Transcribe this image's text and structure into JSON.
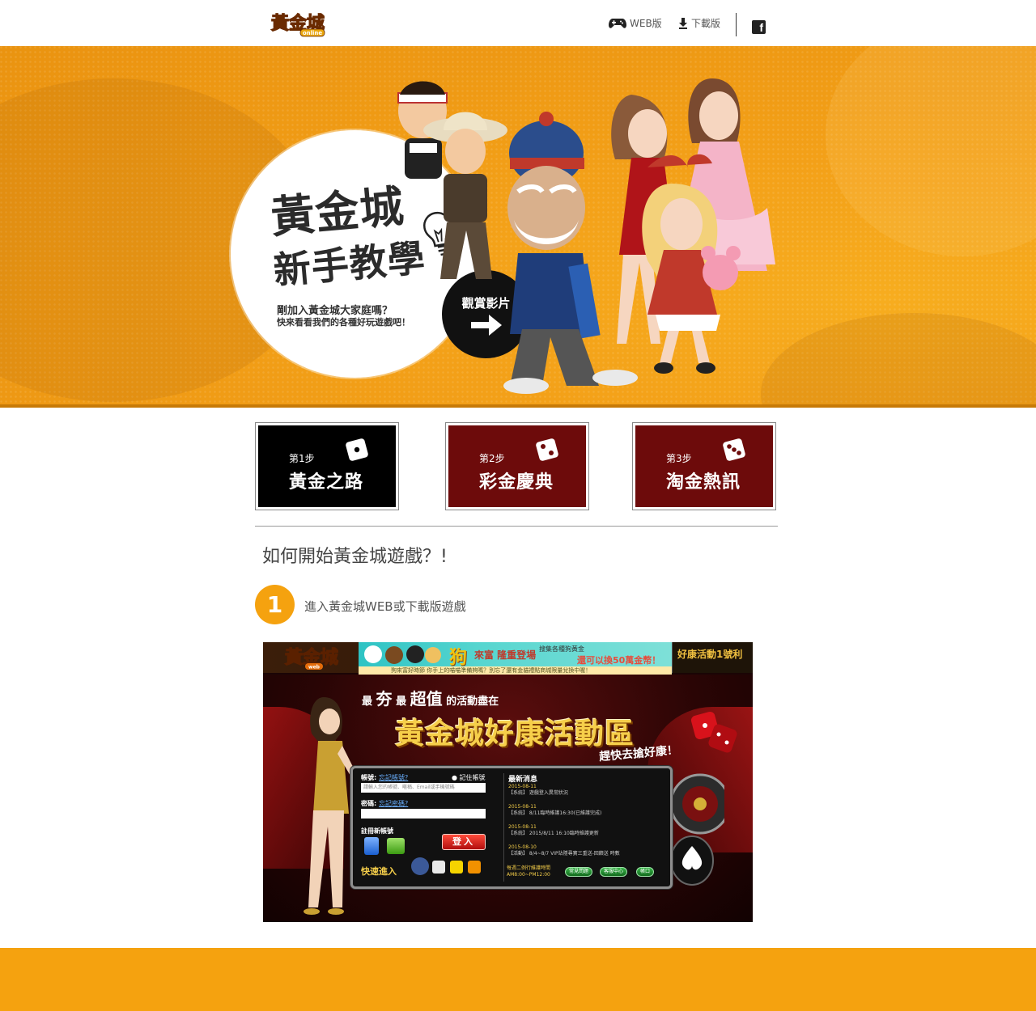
{
  "header": {
    "logo_text": "黃金城",
    "logo_sub": "online",
    "nav_web": "WEB版",
    "nav_download": "下載版",
    "facebook": "f"
  },
  "hero": {
    "title_line1": "黃金城",
    "title_line2": "新手教學",
    "desc_line1": "剛加入黃金城大家庭嗎？",
    "desc_line2": "快來看看我們的各種好玩遊戲吧！",
    "watch_label": "觀賞影片"
  },
  "steps": [
    {
      "num": "第1步",
      "name": "黃金之路"
    },
    {
      "num": "第2步",
      "name": "彩金慶典"
    },
    {
      "num": "第3步",
      "name": "淘金熱訊"
    }
  ],
  "section": {
    "title": "如何開始黃金城遊戲？!",
    "step_number": "1",
    "step_text": "進入黃金城WEB或下載版遊戲"
  },
  "screenshot": {
    "logo_text": "黃金城",
    "logo_sub": "web",
    "banner_dog": "狗",
    "banner_line1": "來富 隆重登場",
    "banner_line2": "搜集各種狗黃金",
    "banner_line3": "還可以換50萬金幣！",
    "side_title": "好康活動1號利",
    "ticker": "狗來富好時節 你手上的喵喵準備夠嗎？別忘了還有金貓禮點商城限量兌換中喔！",
    "headline_pre": "最",
    "headline_big1": "夯",
    "headline_mid": "最",
    "headline_big2": "超值",
    "headline_post": "的活動盡在",
    "main_title": "黃金城好康活動區",
    "sub_title": "趕快去搶好康！",
    "login": {
      "account_label": "帳號:",
      "account_link": "忘記帳號?",
      "remember": "記住帳號",
      "account_placeholder": "請輸入您的帳號、暱稱、Email或手機號碼",
      "password_label": "密碼:",
      "password_link": "忘記密碼?",
      "register": "註冊新帳號",
      "login_button": "登入",
      "quick_entry": "快速進入"
    },
    "news": {
      "title": "最新消息",
      "items": [
        {
          "date": "2015-08-11",
          "text": "【系統】 遊戲登入異常狀況"
        },
        {
          "date": "2015-08-11",
          "text": "【系統】 8/11臨時維護16:30(已維護完成)"
        },
        {
          "date": "2015-08-11",
          "text": "【系統】 2015/8/11 16:10臨時維護更新"
        },
        {
          "date": "2015-08-10",
          "text": "【活動】 8/4~8/7 VIP站隱尋寶三重送-回饋送 時數"
        }
      ],
      "maint_line1": "每週二例行維護時間",
      "maint_line2": "AM8:00~PM12:00",
      "btn1": "常見問題",
      "btn2": "客服中心",
      "btn3": "帳口"
    }
  },
  "colors": {
    "accent_orange": "#f5a20f",
    "step_black": "#000000",
    "step_red": "#6d0b0b"
  }
}
